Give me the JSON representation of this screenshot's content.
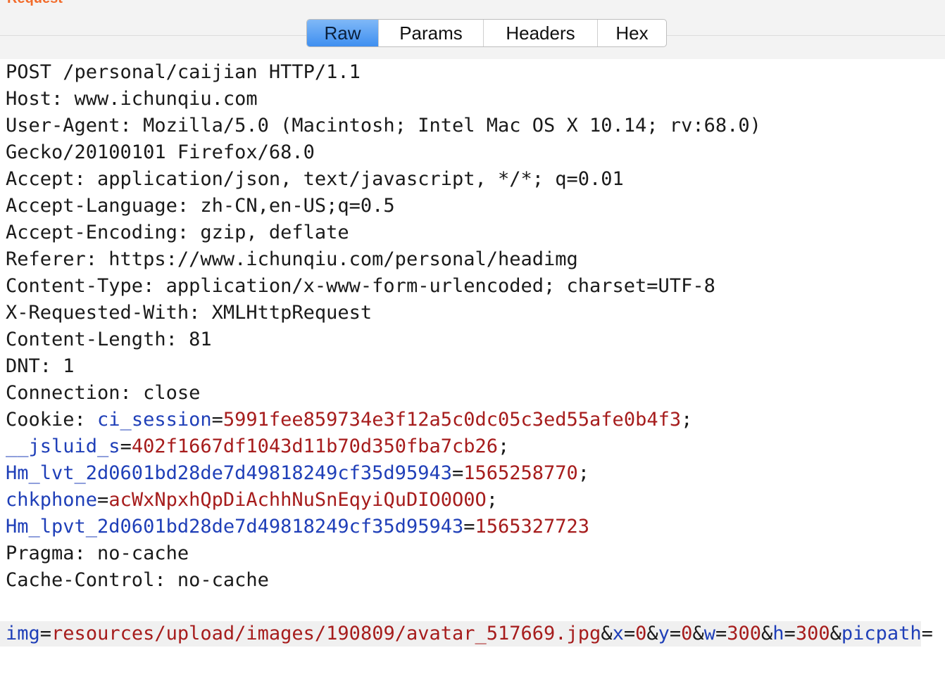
{
  "section": {
    "label": "Request"
  },
  "tabs": [
    {
      "label": "Raw",
      "active": true
    },
    {
      "label": "Params",
      "active": false
    },
    {
      "label": "Headers",
      "active": false
    },
    {
      "label": "Hex",
      "active": false
    }
  ],
  "request": {
    "lines": [
      "POST /personal/caijian HTTP/1.1",
      "Host: www.ichunqiu.com",
      "User-Agent: Mozilla/5.0 (Macintosh; Intel Mac OS X 10.14; rv:68.0)",
      "Gecko/20100101 Firefox/68.0",
      "Accept: application/json, text/javascript, */*; q=0.01",
      "Accept-Language: zh-CN,en-US;q=0.5",
      "Accept-Encoding: gzip, deflate",
      "Referer: https://www.ichunqiu.com/personal/headimg",
      "Content-Type: application/x-www-form-urlencoded; charset=UTF-8",
      "X-Requested-With: XMLHttpRequest",
      "Content-Length: 81",
      "DNT: 1",
      "Connection: close"
    ],
    "cookie_prefix": "Cookie: ",
    "cookies": [
      {
        "name": "ci_session",
        "value": "5991fee859734e3f12a5c0dc05c3ed55afe0b4f3",
        "sep": ";"
      },
      {
        "name": "__jsluid_s",
        "value": "402f1667df1043d11b70d350fba7cb26",
        "sep": ";"
      },
      {
        "name": "Hm_lvt_2d0601bd28de7d49818249cf35d95943",
        "value": "1565258770",
        "sep": ";"
      },
      {
        "name": "chkphone",
        "value": "acWxNpxhQpDiAchhNuSnEqyiQuDIO0O0O",
        "sep": ";"
      },
      {
        "name": "Hm_lpvt_2d0601bd28de7d49818249cf35d95943",
        "value": "1565327723",
        "sep": ""
      }
    ],
    "trailing_lines": [
      "Pragma: no-cache",
      "Cache-Control: no-cache"
    ],
    "body_params": [
      {
        "name": "img",
        "value": "resources/upload/images/190809/avatar_517669.jpg"
      },
      {
        "name": "x",
        "value": "0"
      },
      {
        "name": "y",
        "value": "0"
      },
      {
        "name": "w",
        "value": "300"
      },
      {
        "name": "h",
        "value": "300"
      },
      {
        "name": "picpath",
        "value": ""
      }
    ],
    "colors": {
      "param_name": "#1f3fb8",
      "param_value": "#a61c1c",
      "text": "#1a1a1a"
    }
  }
}
